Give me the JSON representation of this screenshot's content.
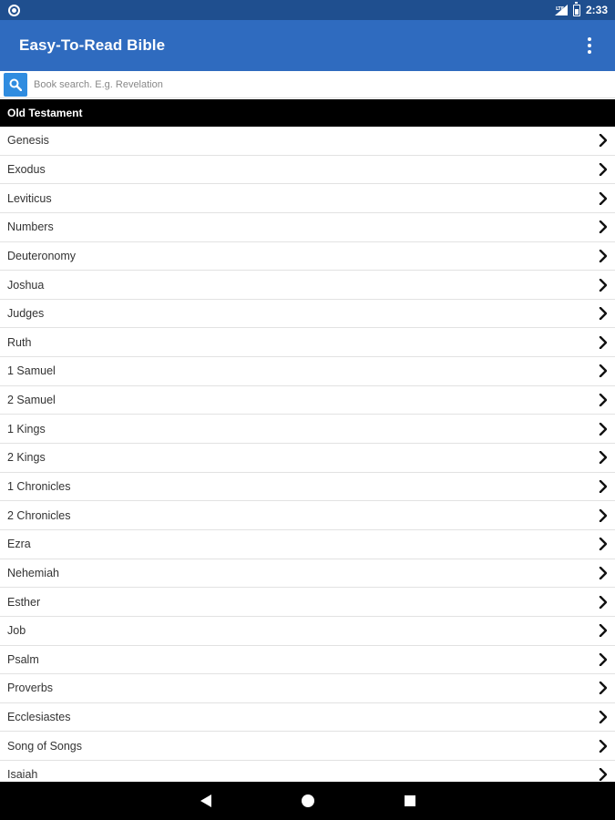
{
  "status_bar": {
    "time": "2:33",
    "icons": [
      "sync-icon",
      "signal-icon",
      "battery-icon"
    ]
  },
  "app_bar": {
    "title": "Easy-To-Read Bible",
    "menu_icon": "overflow-menu-icon"
  },
  "search": {
    "placeholder": "Book search. E.g. Revelation",
    "value": "",
    "icon": "search-icon"
  },
  "section": {
    "title": "Old Testament"
  },
  "books": [
    "Genesis",
    "Exodus",
    "Leviticus",
    "Numbers",
    "Deuteronomy",
    "Joshua",
    "Judges",
    "Ruth",
    "1 Samuel",
    "2 Samuel",
    "1 Kings",
    "2 Kings",
    "1 Chronicles",
    "2 Chronicles",
    "Ezra",
    "Nehemiah",
    "Esther",
    "Job",
    "Psalm",
    "Proverbs",
    "Ecclesiastes",
    "Song of Songs",
    "Isaiah"
  ],
  "nav_bar": {
    "buttons": [
      "back-icon",
      "home-icon",
      "recents-icon"
    ]
  },
  "colors": {
    "status_bar": "#1f4f8f",
    "app_bar": "#2f6bbf",
    "search_button": "#2f8ce0",
    "section_header": "#000000"
  }
}
